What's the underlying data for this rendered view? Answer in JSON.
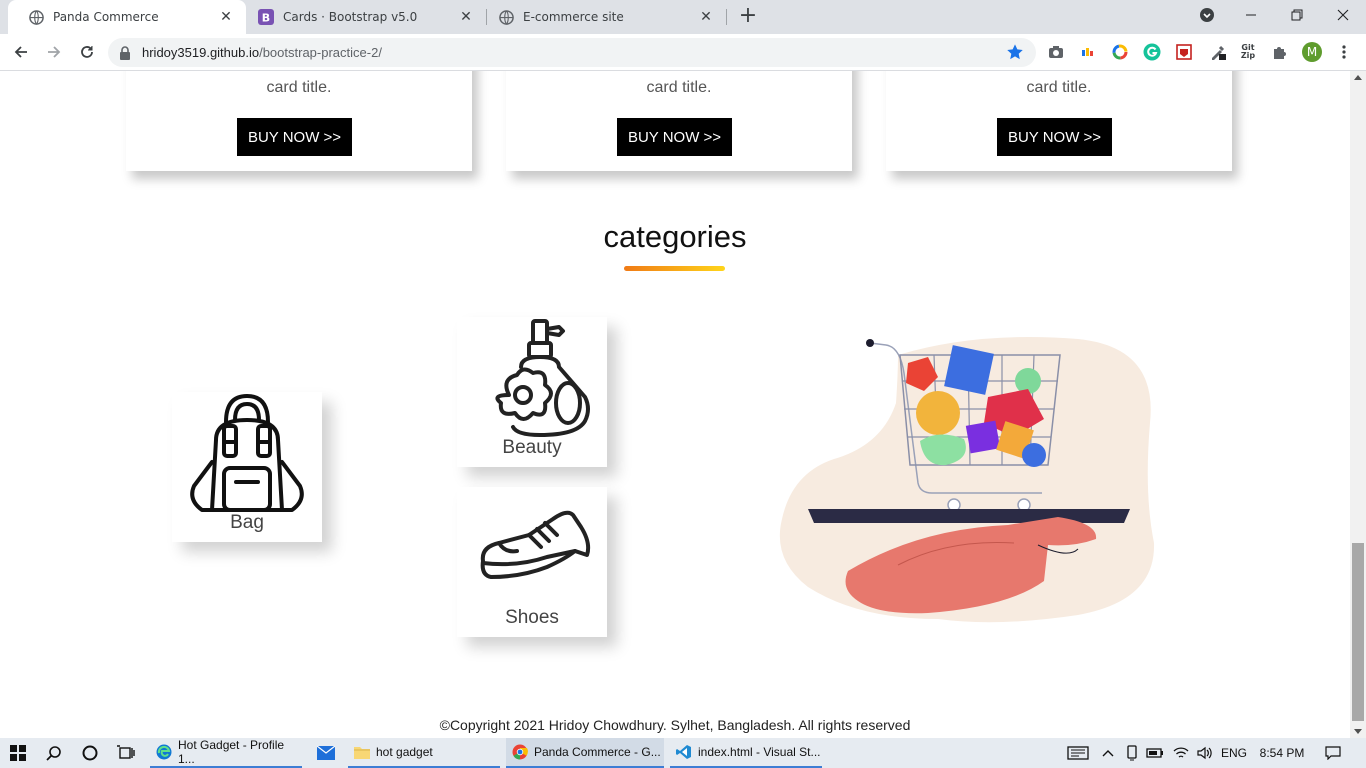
{
  "browser": {
    "tabs": [
      {
        "title": "Panda Commerce",
        "favicon": "globe-icon",
        "active": true
      },
      {
        "title": "Cards · Bootstrap v5.0",
        "favicon": "bootstrap-icon",
        "active": false
      },
      {
        "title": "E-commerce site",
        "favicon": "globe-icon",
        "active": false
      }
    ],
    "url_host": "hridoy3519.github.io",
    "url_path": "/bootstrap-practice-2/",
    "profile_initial": "M",
    "ext_gitzip_top": "Git",
    "ext_gitzip_bottom": "Zip"
  },
  "page": {
    "cards": [
      {
        "text": "card title.",
        "button": "BUY NOW >>"
      },
      {
        "text": "card title.",
        "button": "BUY NOW >>"
      },
      {
        "text": "card title.",
        "button": "BUY NOW >>"
      }
    ],
    "categories_title": "categories",
    "categories": [
      {
        "label": "Bag",
        "icon": "backpack-icon"
      },
      {
        "label": "Beauty",
        "icon": "perfume-icon"
      },
      {
        "label": "Shoes",
        "icon": "shoe-icon"
      }
    ],
    "copyright": "©Copyright 2021 Hridoy Chowdhury. Sylhet, Bangladesh. All rights reserved"
  },
  "taskbar": {
    "apps": [
      {
        "title": "Hot Gadget - Profile 1...",
        "icon": "edge-icon"
      },
      {
        "title": "hot gadget",
        "icon": "folder-icon"
      },
      {
        "title": "Panda Commerce - G...",
        "icon": "chrome-icon"
      },
      {
        "title": "index.html - Visual St...",
        "icon": "vscode-icon"
      }
    ],
    "language": "ENG",
    "time": "8:54 PM"
  },
  "colors": {
    "accent_underline_start": "#f07a16",
    "accent_underline_end": "#ffd51a",
    "button_bg": "#000000",
    "taskbar_accent": "#3d7dd4"
  }
}
